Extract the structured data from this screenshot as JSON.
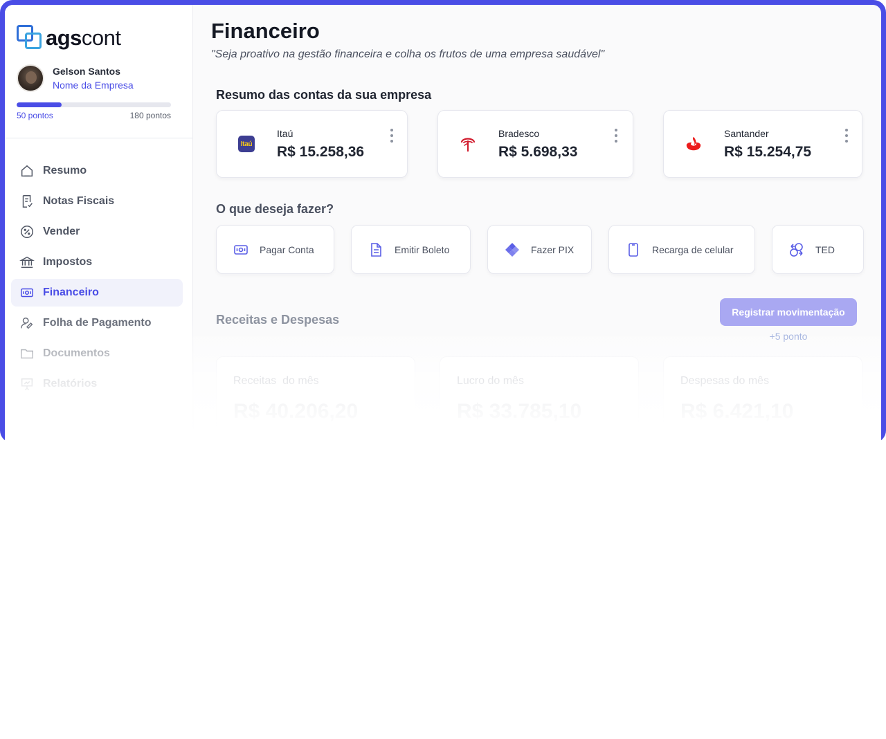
{
  "brand": {
    "logo_bold": "ags",
    "logo_light": "cont"
  },
  "user": {
    "name": "Gelson Santos",
    "company": "Nome da Empresa",
    "points_current": "50 pontos",
    "points_max": "180 pontos",
    "progress_fraction": 0.29
  },
  "sidebar": {
    "items": [
      {
        "label": "Resumo",
        "icon": "home-icon",
        "active": false
      },
      {
        "label": "Notas Fiscais",
        "icon": "invoice-icon",
        "active": false
      },
      {
        "label": "Vender",
        "icon": "percent-icon",
        "active": false
      },
      {
        "label": "Impostos",
        "icon": "bank-building-icon",
        "active": false
      },
      {
        "label": "Financeiro",
        "icon": "money-icon",
        "active": true
      },
      {
        "label": "Folha de Pagamento",
        "icon": "user-edit-icon",
        "active": false
      },
      {
        "label": "Documentos",
        "icon": "folder-icon",
        "active": false
      },
      {
        "label": "Relatórios",
        "icon": "presentation-chart-icon",
        "active": false
      }
    ]
  },
  "page": {
    "title": "Financeiro",
    "quote": "\"Seja proativo na gestão financeira e colha os frutos de uma empresa saudável\""
  },
  "accounts": {
    "title": "Resumo das contas da sua empresa",
    "items": [
      {
        "bank": "Itaú",
        "logo_text": "Itaú",
        "balance": "R$ 15.258,36",
        "icon": "itau-logo-icon"
      },
      {
        "bank": "Bradesco",
        "balance": "R$ 5.698,33",
        "icon": "bradesco-logo-icon"
      },
      {
        "bank": "Santander",
        "balance": "R$ 15.254,75",
        "icon": "santander-logo-icon"
      }
    ]
  },
  "actions": {
    "title": "O que deseja fazer?",
    "items": [
      {
        "label": "Pagar Conta",
        "icon": "money-icon"
      },
      {
        "label": "Emitir Boleto",
        "icon": "document-icon"
      },
      {
        "label": "Fazer PIX",
        "icon": "pix-icon"
      },
      {
        "label": "Recarga de celular",
        "icon": "mobile-icon"
      },
      {
        "label": "TED",
        "icon": "transfer-icon"
      }
    ]
  },
  "finance": {
    "title": "Receitas e Despesas",
    "register_button": "Registrar movimentação",
    "register_points": "+5 ponto",
    "stats": [
      {
        "label": "Receitas  do mês",
        "value": "R$ 40.206,20"
      },
      {
        "label": "Lucro do mês",
        "value": "R$ 33.785,10"
      },
      {
        "label": "Despesas do mês",
        "value": "R$ 6.421,10"
      }
    ]
  },
  "colors": {
    "accent": "#4a4de6",
    "itau": "#3d3e92",
    "itau_text": "#f3c51a",
    "bradesco": "#d21c2e",
    "santander": "#ec1c1c"
  }
}
